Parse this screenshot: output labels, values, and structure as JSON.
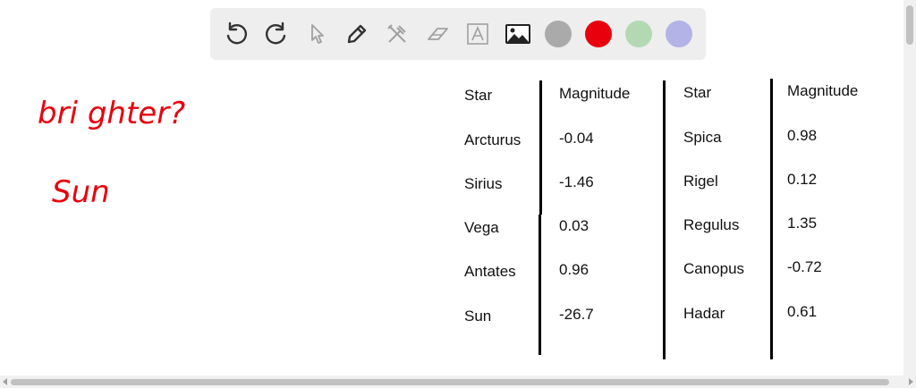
{
  "toolbar": {
    "tools": [
      {
        "name": "undo-icon",
        "enabled": true
      },
      {
        "name": "redo-icon",
        "enabled": true
      },
      {
        "name": "pointer-icon",
        "enabled": false
      },
      {
        "name": "pen-icon",
        "enabled": true
      },
      {
        "name": "tools-icon",
        "enabled": false
      },
      {
        "name": "eraser-icon",
        "enabled": false
      },
      {
        "name": "text-icon",
        "enabled": false
      },
      {
        "name": "image-icon",
        "enabled": true
      }
    ],
    "colors": [
      "#aaaaaa",
      "#e8000d",
      "#b3d9b3",
      "#b3b3e8"
    ],
    "selected_color": "#e8000d"
  },
  "handwriting": {
    "line1": "bri ghter?",
    "line2": "Sun",
    "ink_color": "#e8000d"
  },
  "table": {
    "left": {
      "header": [
        "Star",
        "Magnitude"
      ],
      "rows": [
        [
          "Arcturus",
          "-0.04"
        ],
        [
          "Sirius",
          "-1.46"
        ],
        [
          "Vega",
          "0.03"
        ],
        [
          "Antates",
          "0.96"
        ],
        [
          "Sun",
          "-26.7"
        ]
      ]
    },
    "right": {
      "header": [
        "Star",
        "Magnitude"
      ],
      "rows": [
        [
          "Spica",
          "0.98"
        ],
        [
          "Rigel",
          "0.12"
        ],
        [
          "Regulus",
          "1.35"
        ],
        [
          "Canopus",
          "-0.72"
        ],
        [
          "Hadar",
          "0.61"
        ]
      ]
    }
  }
}
